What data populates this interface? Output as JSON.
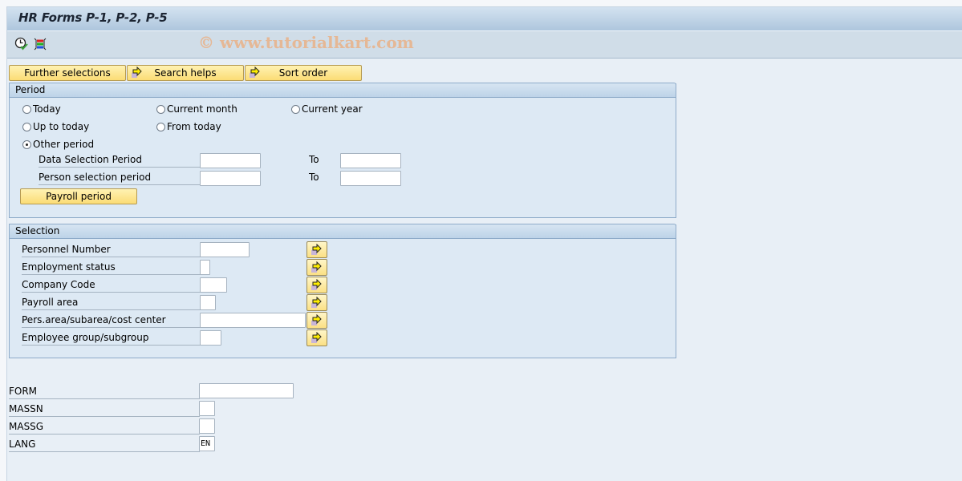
{
  "window": {
    "title": "HR Forms P-1, P-2, P-5",
    "watermark": "© www.tutorialkart.com"
  },
  "toolbar": {
    "icons": [
      "execute-clock-icon",
      "selection-options-icon"
    ]
  },
  "app_toolbar": {
    "further_selections": "Further selections",
    "search_helps": "Search helps",
    "sort_order": "Sort order"
  },
  "period": {
    "header": "Period",
    "options": [
      {
        "label": "Today",
        "selected": false
      },
      {
        "label": "Current month",
        "selected": false
      },
      {
        "label": "Current year",
        "selected": false
      },
      {
        "label": "Up to today",
        "selected": false
      },
      {
        "label": "From today",
        "selected": false
      },
      {
        "label": "Other period",
        "selected": true
      }
    ],
    "data_selection_label": "Data Selection Period",
    "person_selection_label": "Person selection period",
    "to_label": "To",
    "data_selection_from": "",
    "data_selection_to": "",
    "person_selection_from": "",
    "person_selection_to": "",
    "payroll_period_button": "Payroll period"
  },
  "selection": {
    "header": "Selection",
    "fields": [
      {
        "label": "Personnel Number",
        "value": ""
      },
      {
        "label": "Employment status",
        "value": ""
      },
      {
        "label": "Company Code",
        "value": ""
      },
      {
        "label": "Payroll area",
        "value": ""
      },
      {
        "label": "Pers.area/subarea/cost center",
        "value": ""
      },
      {
        "label": "Employee group/subgroup",
        "value": ""
      }
    ]
  },
  "parameters": {
    "fields": [
      {
        "label": "FORM",
        "value": ""
      },
      {
        "label": "MASSN",
        "value": ""
      },
      {
        "label": "MASSG",
        "value": ""
      },
      {
        "label": "LANG",
        "value": "EN"
      }
    ]
  }
}
